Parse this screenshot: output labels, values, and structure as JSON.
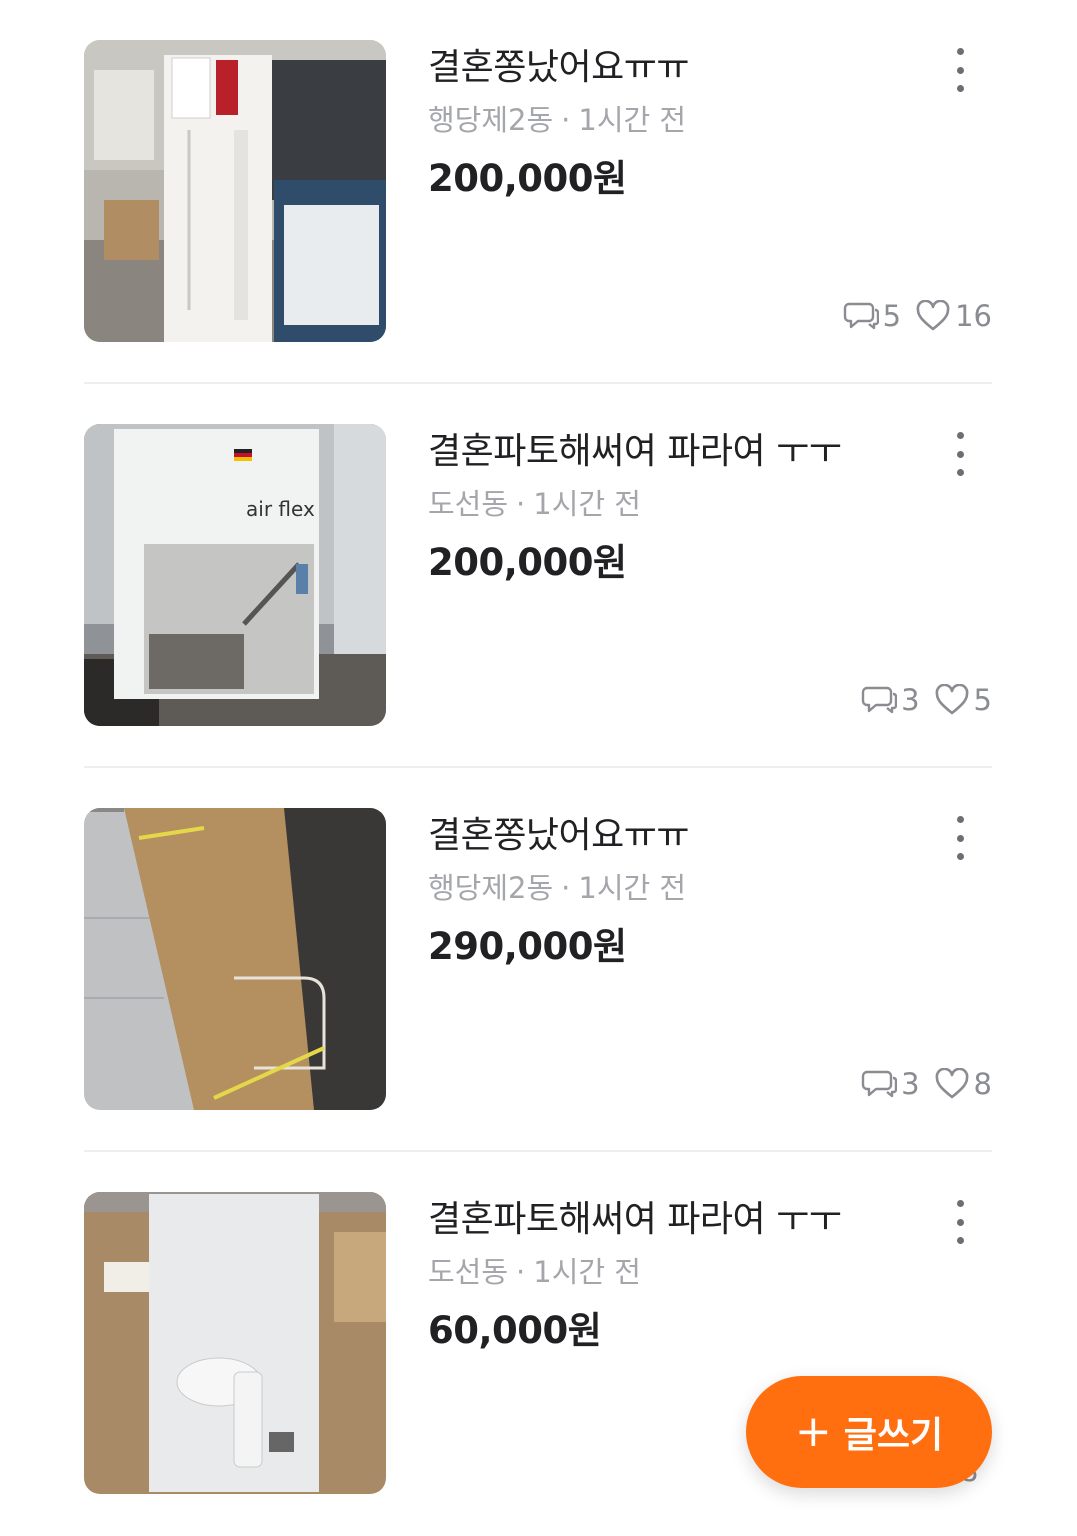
{
  "listings": [
    {
      "title": "결혼쫑났어요ㅠㅠ",
      "location": "행당제2동",
      "time": "1시간 전",
      "price": "200,000원",
      "comments": "5",
      "likes": "16",
      "image": "vacuum-box-white-storm"
    },
    {
      "title": "결혼파토해써여 파라여 ㅜㅜ",
      "location": "도선동",
      "time": "1시간 전",
      "price": "200,000원",
      "comments": "3",
      "likes": "5",
      "image": "vacuum-box-air-flex"
    },
    {
      "title": "결혼쫑났어요ㅠㅠ",
      "location": "행당제2동",
      "time": "1시간 전",
      "price": "290,000원",
      "comments": "3",
      "likes": "8",
      "image": "air-purifier-cardboard-box"
    },
    {
      "title": "결혼파토해써여 파라여 ㅜㅜ",
      "location": "도선동",
      "time": "1시간 전",
      "price": "60,000원",
      "comments": "",
      "likes": "8",
      "image": "hair-dryer-box"
    }
  ],
  "separator": "·",
  "fab": {
    "icon": "plus-icon",
    "label": "글쓰기",
    "color": "#ff6f0f"
  }
}
